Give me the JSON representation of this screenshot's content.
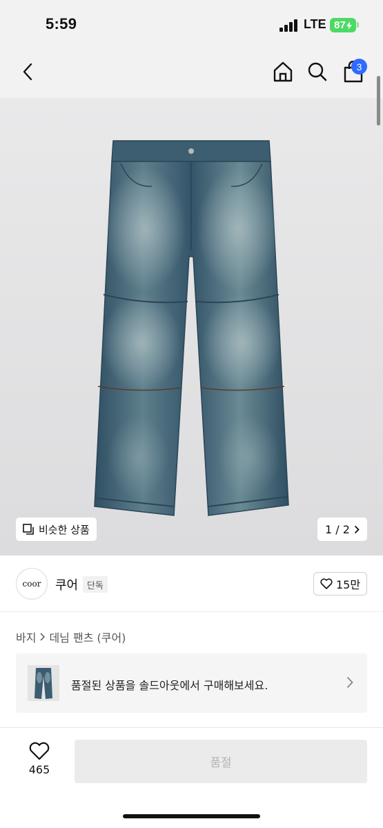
{
  "status_bar": {
    "time": "5:59",
    "network": "LTE",
    "battery": "87"
  },
  "nav": {
    "cart_count": "3"
  },
  "icons": {
    "back": "chevron-left-icon",
    "home": "home-icon",
    "search": "search-icon",
    "cart": "shopping-bag-icon",
    "similar": "copy-icon",
    "heart": "heart-icon"
  },
  "image": {
    "similar_label": "비슷한 상품",
    "pager": "1 / 2"
  },
  "brand": {
    "logo_text": "coor",
    "name": "쿠어",
    "badge": "단독",
    "likes": "15만"
  },
  "breadcrumb": {
    "category": "바지",
    "product": "데님 팬츠 (쿠어)"
  },
  "soldout_banner": {
    "text": "품절된 상품을 솔드아웃에서 구매해보세요."
  },
  "bottom": {
    "wish_count": "465",
    "button_label": "품절"
  },
  "colors": {
    "accent_badge": "#2f6bff",
    "battery": "#4cd964",
    "denim": "#3b5d72"
  }
}
